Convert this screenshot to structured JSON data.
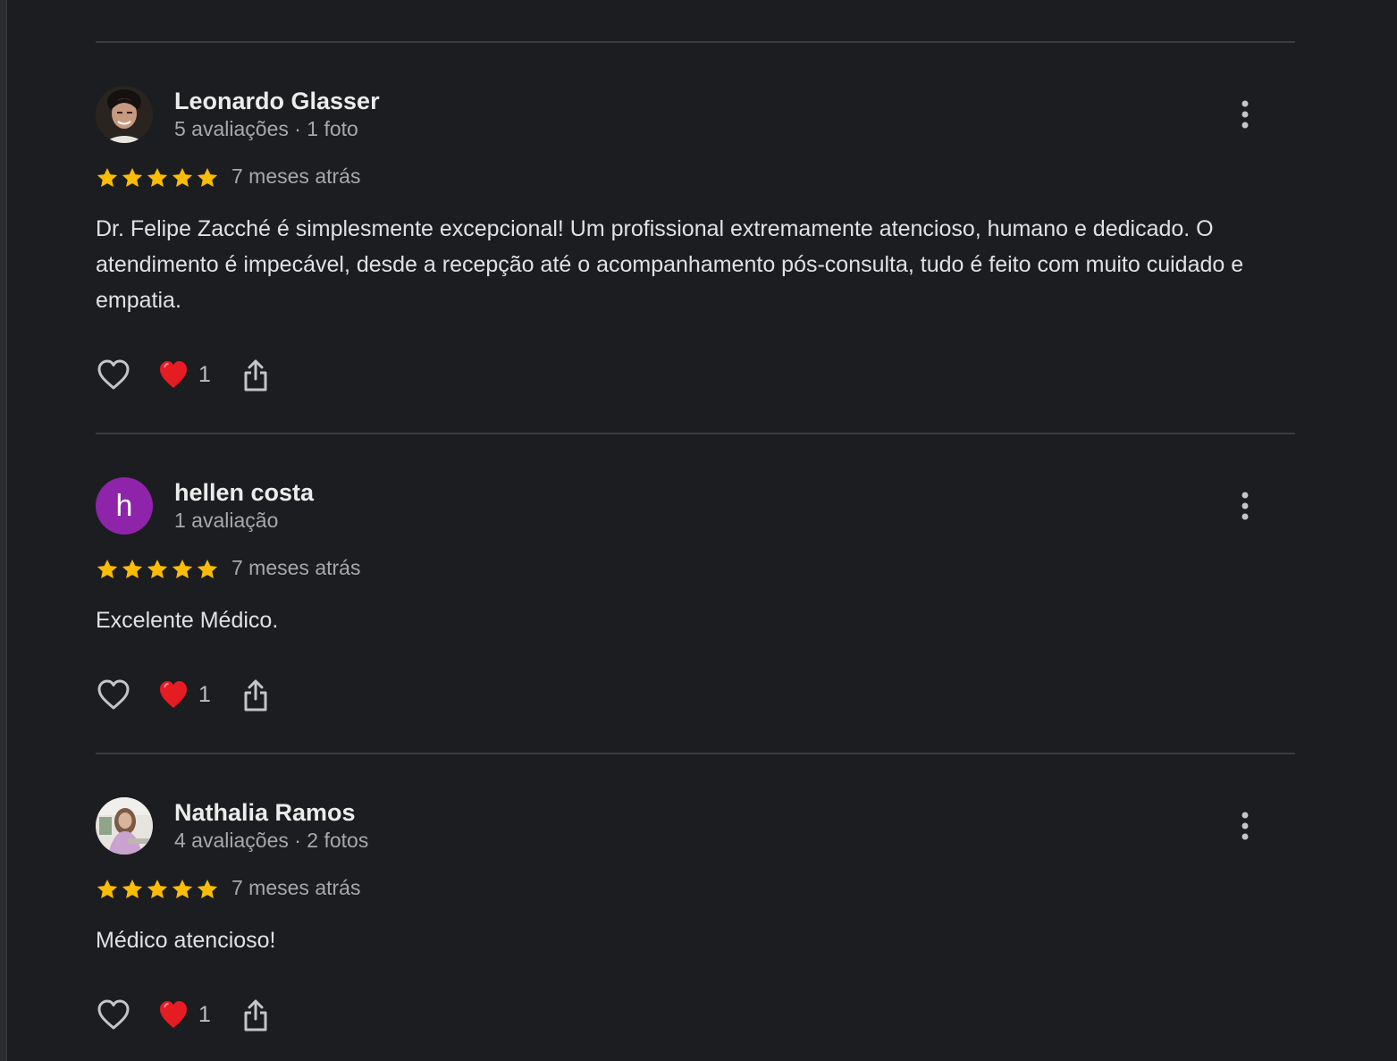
{
  "reviews": [
    {
      "name": "Leonardo Glasser",
      "meta": "5 avaliações · 1 foto",
      "avatar": {
        "type": "photo",
        "icon": "person-photo"
      },
      "rating": 5,
      "date": "7 meses atrás",
      "text": "Dr. Felipe Zacché é simplesmente excepcional! Um profissional extremamente atencioso, humano e dedicado. O atendimento é impecável, desde a recepção até o acompanhamento pós-consulta, tudo é feito com muito cuidado e empatia.",
      "reaction_count": "1"
    },
    {
      "name": "hellen costa",
      "meta": "1 avaliação",
      "avatar": {
        "type": "letter",
        "letter": "h",
        "color": "#8e24aa"
      },
      "rating": 5,
      "date": "7 meses atrás",
      "text": "Excelente Médico.",
      "reaction_count": "1"
    },
    {
      "name": "Nathalia Ramos",
      "meta": "4 avaliações · 2 fotos",
      "avatar": {
        "type": "photo",
        "icon": "person-photo"
      },
      "rating": 5,
      "date": "7 meses atrás",
      "text": "Médico atencioso!",
      "reaction_count": "1"
    }
  ],
  "colors": {
    "background": "#1c1d20",
    "star": "#fbbc04",
    "heart": "#e51c23",
    "divider": "#3b3c40"
  },
  "icons": [
    "more-vert-icon",
    "star-icon",
    "like-outline-icon",
    "red-heart-icon",
    "share-icon"
  ]
}
